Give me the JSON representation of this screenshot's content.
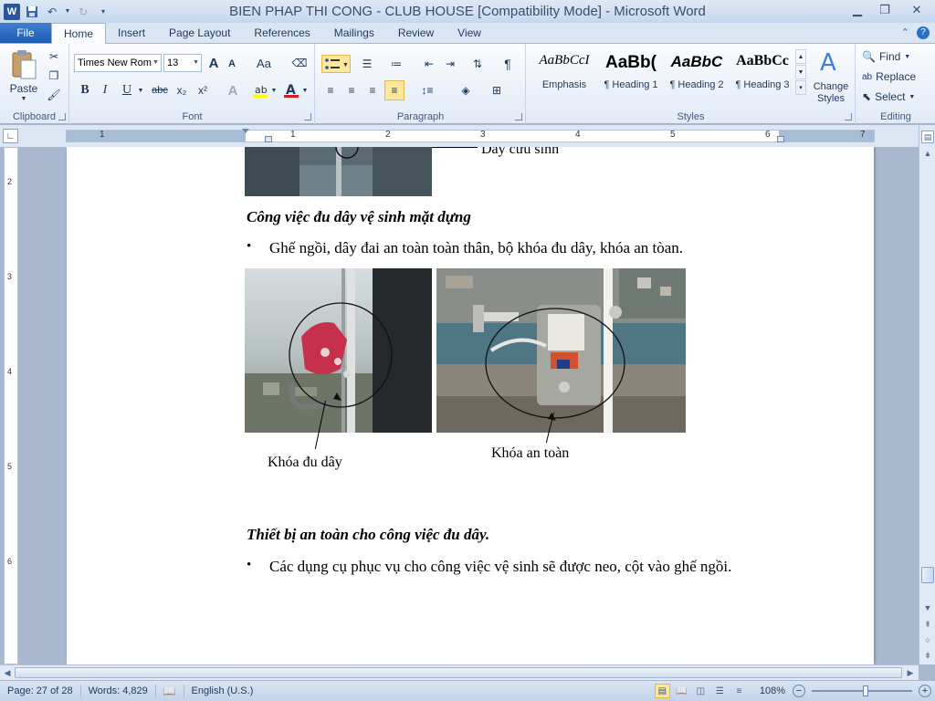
{
  "window": {
    "title": "BIEN PHAP THI CONG - CLUB HOUSE [Compatibility Mode]  -  Microsoft Word",
    "app_icon_letter": "W"
  },
  "tabs": [
    {
      "label": "File"
    },
    {
      "label": "Home"
    },
    {
      "label": "Insert"
    },
    {
      "label": "Page Layout"
    },
    {
      "label": "References"
    },
    {
      "label": "Mailings"
    },
    {
      "label": "Review"
    },
    {
      "label": "View"
    }
  ],
  "ribbon": {
    "clipboard": {
      "label": "Clipboard",
      "paste": "Paste"
    },
    "font": {
      "label": "Font",
      "font_name": "Times New Rom",
      "font_size": "13",
      "bold": "B",
      "italic": "I",
      "underline": "U",
      "strike": "abc",
      "subscript": "x₂",
      "superscript": "x²",
      "grow": "A",
      "shrink": "A",
      "case": "Aa"
    },
    "paragraph": {
      "label": "Paragraph"
    },
    "styles": {
      "label": "Styles",
      "items": [
        {
          "sample": "AaBbCcI",
          "name": "Emphasis"
        },
        {
          "sample": "AaBb(",
          "name": "¶ Heading 1"
        },
        {
          "sample": "AaBbC",
          "name": "¶ Heading 2"
        },
        {
          "sample": "AaBbCc",
          "name": "¶ Heading 3"
        }
      ],
      "change_styles": "Change Styles"
    },
    "editing": {
      "label": "Editing",
      "find": "Find",
      "replace": "Replace",
      "select": "Select"
    }
  },
  "ruler": {
    "h_numbers": [
      "1",
      "1",
      "2",
      "3",
      "4",
      "5",
      "6",
      "7"
    ],
    "v_numbers": [
      "2",
      "3",
      "4",
      "5",
      "6"
    ]
  },
  "document": {
    "caption_top_partial": "Dây cứu sinh",
    "heading1": "Công việc đu dây vệ sinh mặt dựng",
    "bullet1": "Ghế ngồi, dây đai an toàn toàn thân, bộ khóa đu dây, khóa an tòan.",
    "caption_left": "Khóa đu dây",
    "caption_right": "Khóa an toàn",
    "heading2": "Thiết bị an toàn cho công việc đu dây.",
    "bullet2": "Các dụng cụ phục vụ cho công việc vệ sinh sẽ được neo, cột vào ghế ngồi.",
    "bullet_glyph": "•"
  },
  "status": {
    "page": "Page: 27 of 28",
    "words": "Words: 4,829",
    "language": "English (U.S.)",
    "zoom": "108%"
  }
}
